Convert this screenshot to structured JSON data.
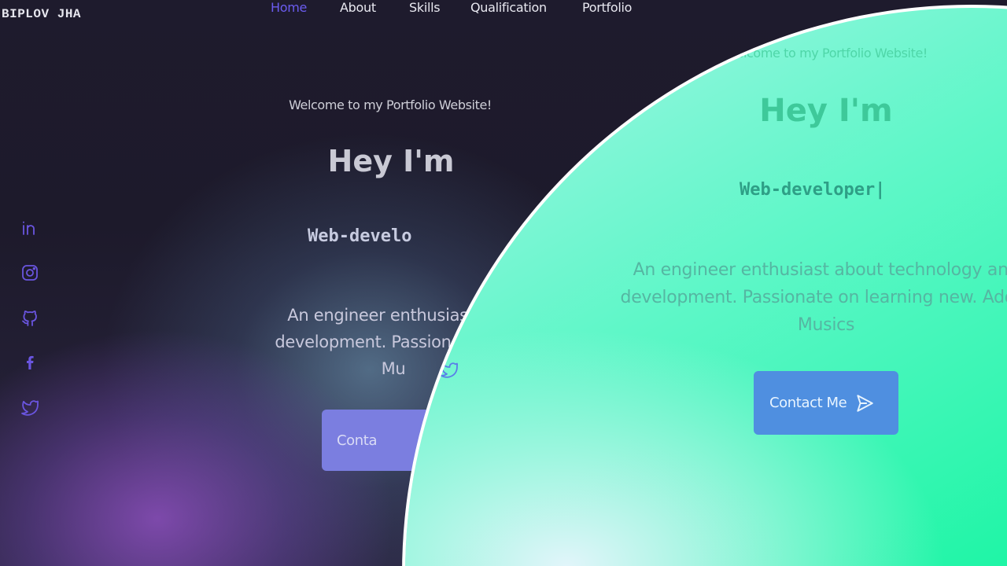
{
  "brand": "BIPLOV JHA",
  "nav": [
    {
      "label": "Home",
      "active": true
    },
    {
      "label": "About"
    },
    {
      "label": "Skills"
    },
    {
      "label": "Qualification"
    },
    {
      "label": "Portfolio"
    }
  ],
  "hero": {
    "welcome": "Welcome to my Portfolio Website!",
    "greeting": "Hey I'm",
    "role": "Web-developer",
    "description_line1": "An engineer enthusiast about technology and",
    "description_line2": "development. Passionate on learning new. Adore",
    "description_line3": "Musics",
    "button_label": "Contact Me"
  },
  "dark_view": {
    "role": "Web-develo",
    "description_line1": "An engineer enthusiast ab",
    "description_line2": "development. Passionate on l",
    "description_line3": "Mu",
    "button_label": "Conta"
  },
  "light_view": {
    "role": "Web-developer|",
    "description_line1": "An engineer enthusiast about technology and",
    "description_line2": "development. Passionate on learning new. Adore",
    "description_line3": "Musics"
  },
  "social_icons": [
    "linkedin-icon",
    "instagram-icon",
    "github-icon",
    "facebook-icon",
    "twitter-icon"
  ],
  "colors": {
    "dark_bg": "#1d1a2c",
    "accent_purple": "#6b5cf0",
    "light_green": "#1ff5a6",
    "button_blue": "#4f8fe0"
  }
}
